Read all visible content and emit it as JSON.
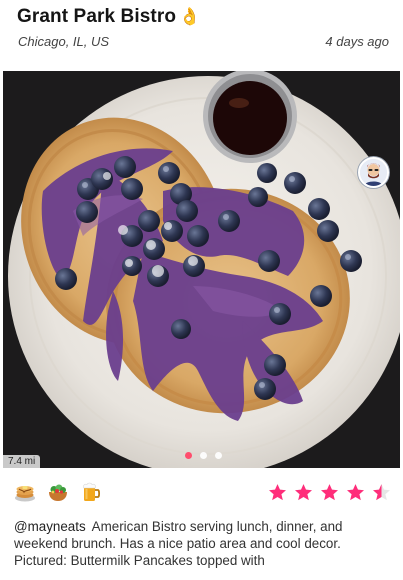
{
  "post": {
    "restaurant_name": "Grant Park Bistro",
    "title_emoji": "👌",
    "location": "Chicago, IL, US",
    "posted_ago": "4 days ago",
    "distance": "7.4 mi",
    "author_handle": "@mayneats",
    "description": "American Bistro serving lunch, dinner, and weekend brunch. Has a nice patio area and cool decor. Pictured: Buttermilk Pancakes topped with",
    "carousel": {
      "count": 3,
      "active_index": 0
    },
    "rating": {
      "value": 4.5,
      "max": 5
    }
  },
  "icons": {
    "avatar": "user-avatar",
    "actions": [
      "pancakes-icon",
      "salad-icon",
      "beer-mug-icon"
    ],
    "star": "star-icon"
  },
  "colors": {
    "accent": "#ff2d7a",
    "active_dot": "#ff4d6d",
    "photo_background": "#1c1b1c"
  }
}
